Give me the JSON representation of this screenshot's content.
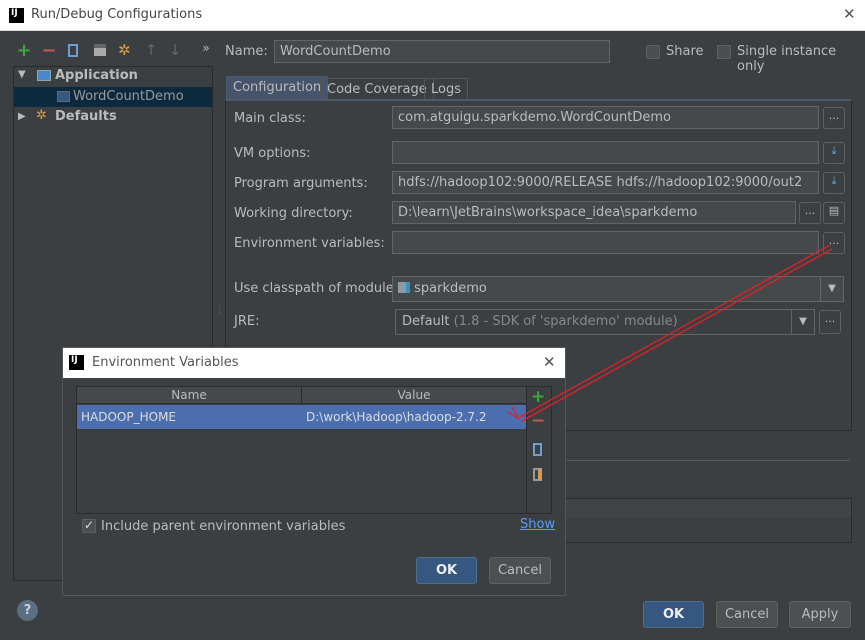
{
  "window": {
    "title": "Run/Debug Configurations",
    "close": "✕"
  },
  "toolbar": {
    "add": "+",
    "remove": "−",
    "copy": "copy",
    "save": "save",
    "wrench": "wrench",
    "up": "↑",
    "down": "↓",
    "more": "»"
  },
  "tree": {
    "items": [
      {
        "label": "Application",
        "expanded": true
      },
      {
        "label": "WordCountDemo",
        "selected": true
      },
      {
        "label": "Defaults",
        "expanded": false
      }
    ]
  },
  "name": {
    "label": "Name:",
    "value": "WordCountDemo"
  },
  "share": {
    "label": "Share",
    "checked": false
  },
  "single_instance": {
    "label": "Single instance only",
    "checked": false
  },
  "tabs": [
    {
      "label": "Configuration",
      "active": true
    },
    {
      "label": "Code Coverage"
    },
    {
      "label": "Logs"
    }
  ],
  "form": {
    "main_class": {
      "label": "Main class:",
      "value": "com.atguigu.sparkdemo.WordCountDemo"
    },
    "vm_options": {
      "label": "VM options:",
      "value": ""
    },
    "program_arguments": {
      "label": "Program arguments:",
      "value": "hdfs://hadoop102:9000/RELEASE hdfs://hadoop102:9000/out2"
    },
    "working_directory": {
      "label": "Working directory:",
      "value": "D:\\learn\\JetBrains\\workspace_idea\\sparkdemo"
    },
    "environment_variables": {
      "label": "Environment variables:",
      "value": ""
    },
    "classpath_module": {
      "label": "Use classpath of module:",
      "value": "sparkdemo"
    },
    "jre": {
      "label": "JRE:",
      "value": "Default",
      "hint": "(1.8 - SDK of 'sparkdemo' module)"
    },
    "ellipsis": "..."
  },
  "buttons": {
    "ok": "OK",
    "cancel": "Cancel",
    "apply": "Apply",
    "help": "?"
  },
  "env_dialog": {
    "title": "Environment Variables",
    "close": "✕",
    "columns": [
      "Name",
      "Value"
    ],
    "rows": [
      {
        "name": "HADOOP_HOME",
        "value": "D:\\work\\Hadoop\\hadoop-2.7.2",
        "selected": true
      }
    ],
    "add": "+",
    "remove": "−",
    "include_parent": {
      "label": "Include parent environment variables",
      "checked": true
    },
    "show": "Show",
    "ok": "OK",
    "cancel": "Cancel"
  },
  "colors": {
    "accent": "#4b6eaf",
    "annotation_arrow": "#e0202a",
    "background": "#3c3f41"
  }
}
